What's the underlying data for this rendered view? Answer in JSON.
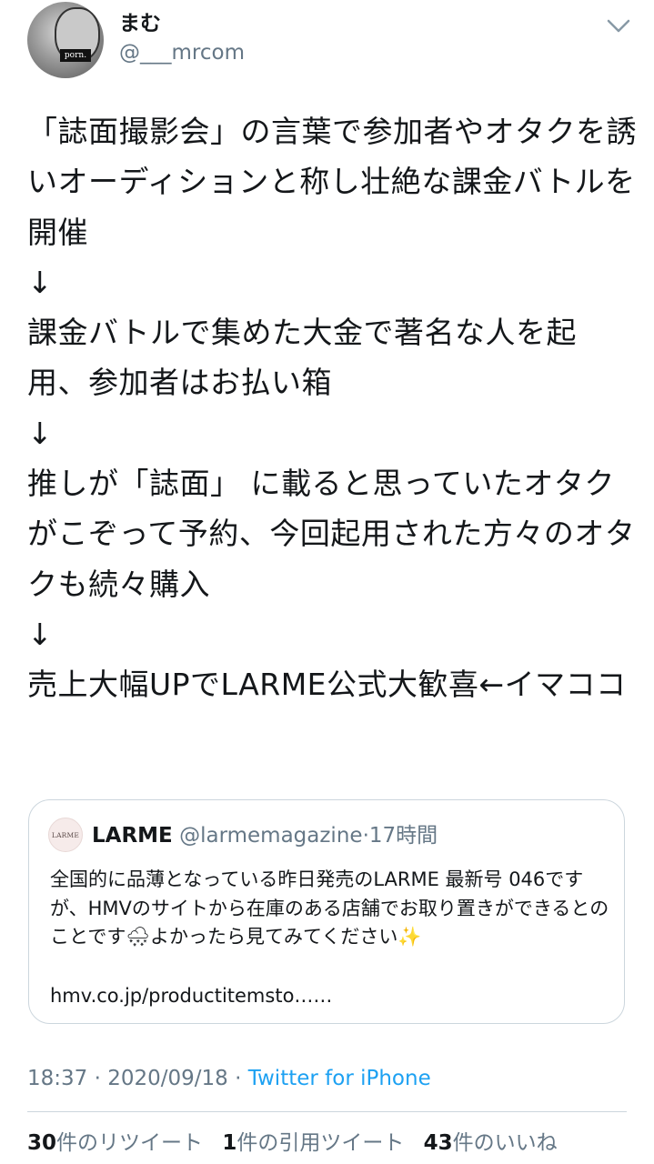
{
  "author": {
    "display_name": "まむ",
    "handle": "@___mrcom",
    "avatar_tag": "porn."
  },
  "tweet": {
    "body": "「誌面撮影会」の言葉で参加者やオタクを誘いオーディションと称し壮絶な課金バトルを開催\n↓\n課金バトルで集めた大金で著名な人を起用、参加者はお払い箱\n↓\n推しが「誌面」 に載ると思っていたオタクがこぞって予約、今回起用された方々のオタクも続々購入\n↓\n売上大幅UPでLARME公式大歓喜←イマココ"
  },
  "quote": {
    "avatar_text": "LARME",
    "name": "LARME",
    "handle": "@larmemagazine",
    "dot": "·",
    "time": "17時間",
    "text": "全国的に品薄となっている昨日発売のLARME 最新号 046ですが、HMVのサイトから在庫のある店舗でお取り置きができるとのことです🌨よかったら見てみてください✨",
    "link": "hmv.co.jp/productitemsto……"
  },
  "meta": {
    "time": "18:37",
    "sep1": " · ",
    "date": "2020/09/18",
    "sep2": " · ",
    "source": "Twitter for iPhone"
  },
  "stats": {
    "retweets_count": "30",
    "retweets_label": "件のリツイート",
    "quotes_count": "1",
    "quotes_label": "件の引用ツイート",
    "likes_count": "43",
    "likes_label": "件のいいね"
  },
  "colors": {
    "text": "#14171a",
    "secondary": "#657786",
    "link": "#1da1f2",
    "border": "#ccd6dd"
  },
  "icons": {
    "menu": "chevron-down-icon"
  }
}
